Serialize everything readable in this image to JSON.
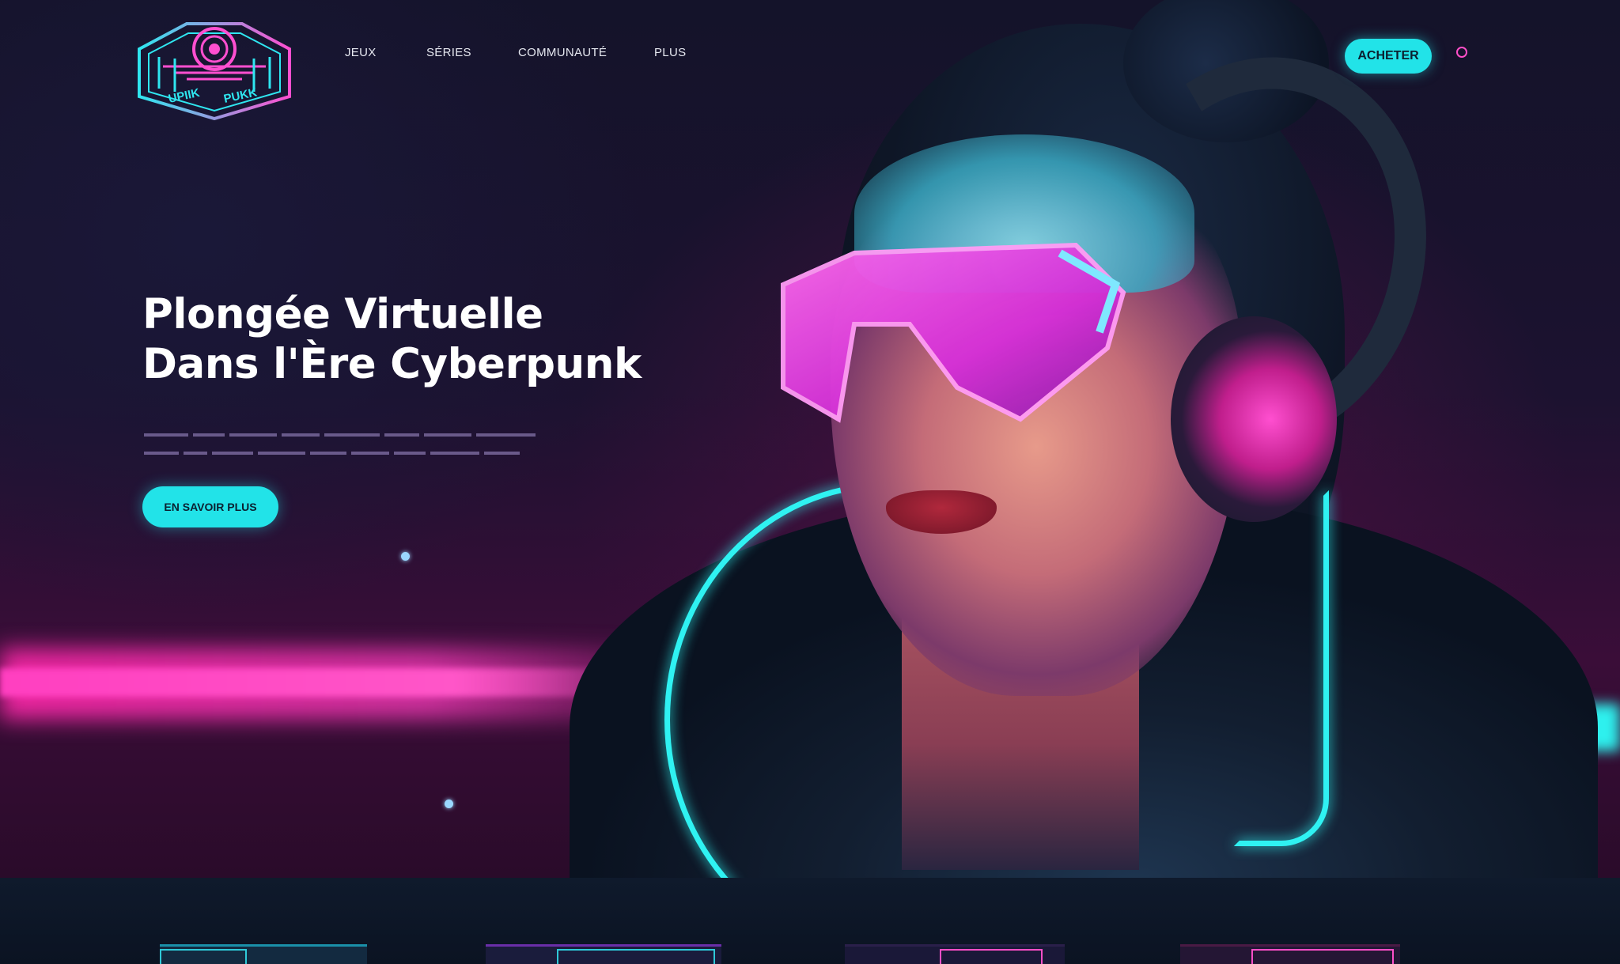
{
  "brand": {
    "logo_text_left": "UPIIK",
    "logo_text_right": "PUKK"
  },
  "nav": {
    "items": [
      {
        "label": "JEUX"
      },
      {
        "label": "SÉRIES"
      },
      {
        "label": "COMMUNAUTÉ"
      },
      {
        "label": "PLUS"
      }
    ]
  },
  "header": {
    "buy_label": "ACHETER"
  },
  "hero": {
    "title_line1": "Plongée Virtuelle",
    "title_line2": "Dans l'Ère Cyberpunk",
    "cta_label": "EN SAVOIR PLUS"
  },
  "colors": {
    "accent_cyan": "#22e3e8",
    "accent_pink": "#ff3fc0",
    "background": "#0a1222"
  },
  "icons": {
    "menu": "circle-menu-icon",
    "logo": "cyber-shield-logo-icon"
  }
}
